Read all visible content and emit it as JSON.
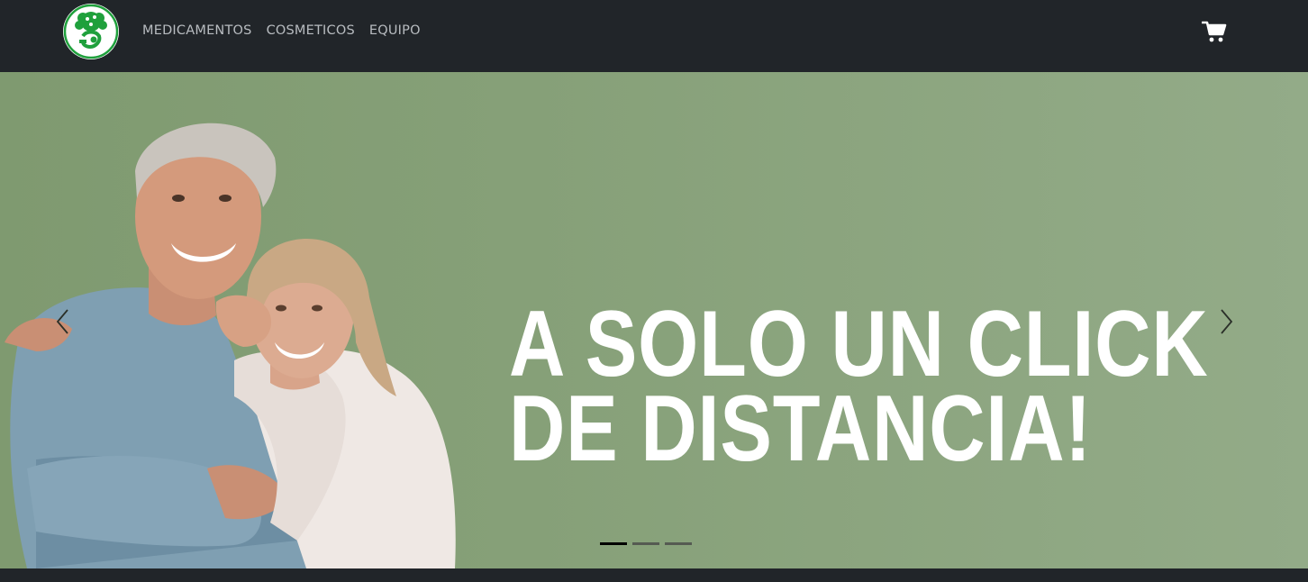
{
  "navbar": {
    "logo_icon": "pharmacy-tree-logo",
    "links": [
      "MEDICAMENTOS",
      "COSMETICOS",
      "EQUIPO"
    ],
    "cart_icon": "shopping-cart-icon"
  },
  "carousel": {
    "caption_line1": "A SOLO UN CLICK",
    "caption_line2": "DE DISTANCIA!",
    "prev_icon": "chevron-left-icon",
    "next_icon": "chevron-right-icon",
    "slide_count": 3,
    "active_slide": 1
  },
  "colors": {
    "navbar_bg": "#212529",
    "hero_bg": "#86a078",
    "logo_green": "#1fa03c",
    "caption": "#ffffff"
  }
}
